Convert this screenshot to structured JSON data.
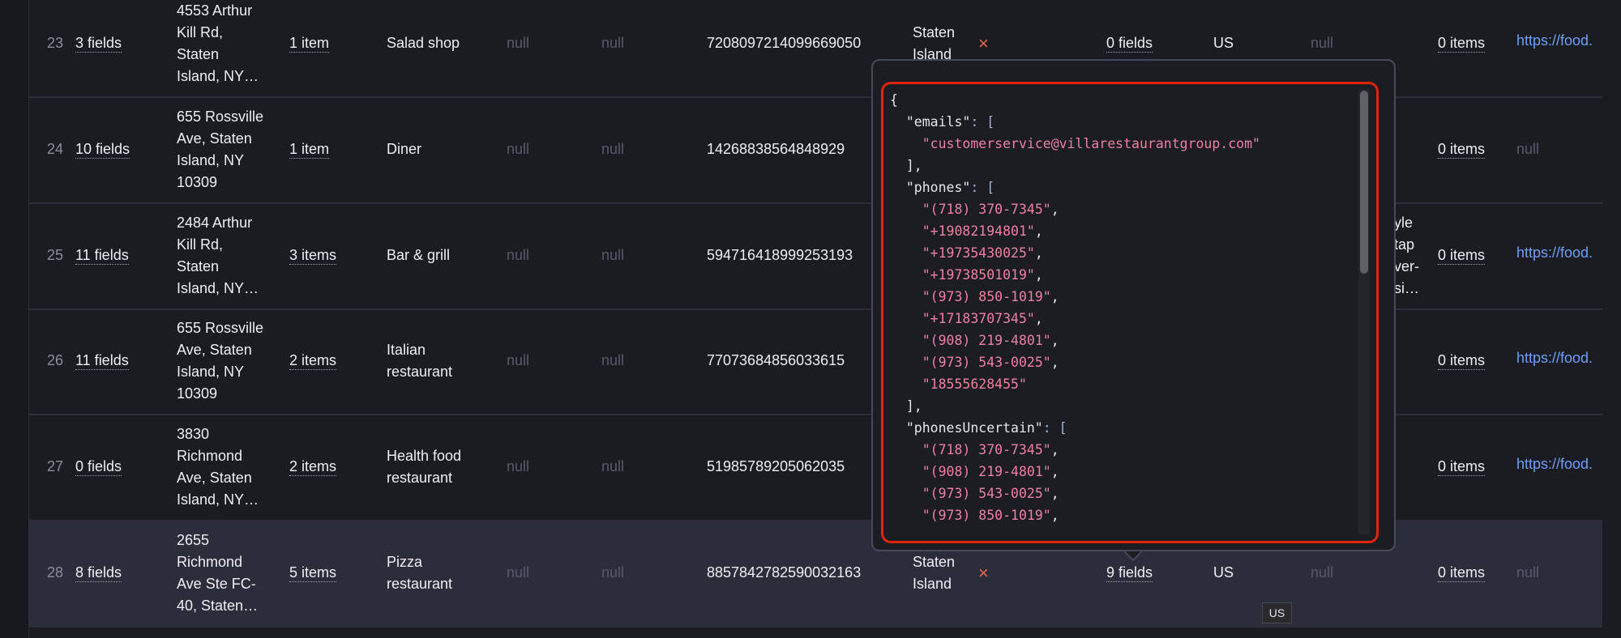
{
  "colors": {
    "background": "#1b1c21",
    "highlight_row": "#2b2e3a",
    "null_text": "#555a6c",
    "link": "#6f9ff5",
    "cross": "#e8664e",
    "highlight_border": "#e0250c",
    "json_string": "#ef7fa3"
  },
  "rows": [
    {
      "num": "23",
      "fields": "3 fields",
      "address": [
        "4553 Arthur",
        "Kill Rd,",
        "Staten",
        "Island, NY…"
      ],
      "items": "1 item",
      "category": [
        "Salad shop"
      ],
      "c5": "null",
      "c6": "null",
      "id": "7208097214099669050",
      "city": [
        "Staten",
        "Island"
      ],
      "flag": "×",
      "fields2": "0 fields",
      "country": "US",
      "c12": "null",
      "items2": "0 items",
      "url": "https://food."
    },
    {
      "num": "24",
      "fields": "10 fields",
      "address": [
        "655 Rossville",
        "Ave, Staten",
        "Island, NY",
        "10309"
      ],
      "items": "1 item",
      "category": [
        "Diner"
      ],
      "c5": "null",
      "c6": "null",
      "id": "14268838564848929",
      "items2": "0 items",
      "url_null": "null"
    },
    {
      "num": "25",
      "fields": "11 fields",
      "address": [
        "2484 Arthur",
        "Kill Rd,",
        "Staten",
        "Island, NY…"
      ],
      "items": "3 items",
      "category": [
        "Bar & grill"
      ],
      "c5": "null",
      "c6": "null",
      "id": "594716418999253193",
      "fragment": [
        "yle",
        "tap",
        "ver-",
        "si…"
      ],
      "items2": "0 items",
      "url": "https://food."
    },
    {
      "num": "26",
      "fields": "11 fields",
      "address": [
        "655 Rossville",
        "Ave, Staten",
        "Island, NY",
        "10309"
      ],
      "items": "2 items",
      "category": [
        "Italian",
        "restaurant"
      ],
      "c5": "null",
      "c6": "null",
      "id": "77073684856033615",
      "items2": "0 items",
      "url": "https://food."
    },
    {
      "num": "27",
      "fields": "0 fields",
      "address": [
        "3830",
        "Richmond",
        "Ave, Staten",
        "Island, NY…"
      ],
      "items": "2 items",
      "category": [
        "Health food",
        "restaurant"
      ],
      "c5": "null",
      "c6": "null",
      "id": "51985789205062035",
      "items2": "0 items",
      "url": "https://food."
    },
    {
      "num": "28",
      "fields": "8 fields",
      "address": [
        "2655",
        "Richmond",
        "Ave Ste FC-",
        "40, Staten…"
      ],
      "items": "5 items",
      "category": [
        "Pizza",
        "restaurant"
      ],
      "c5": "null",
      "c6": "null",
      "id": "8857842782590032163",
      "city": [
        "Staten",
        "Island"
      ],
      "flag": "×",
      "fields2": "9 fields",
      "country": "US",
      "c12": "null",
      "items2": "0 items",
      "url_null": "null",
      "highlighted": true
    }
  ],
  "popup": {
    "json": {
      "emails": [
        "customerservice@villarestaurantgroup.com"
      ],
      "phones": [
        "(718) 370-7345",
        "+19082194801",
        "+19735430025",
        "+19738501019",
        "(973) 850-1019",
        "+17183707345",
        "(908) 219-4801",
        "(973) 543-0025",
        "18555628455"
      ],
      "phonesUncertain": [
        "(718) 370-7345",
        "(908) 219-4801",
        "(973) 543-0025",
        "(973) 850-1019"
      ]
    }
  },
  "tooltip": {
    "text": "US"
  }
}
